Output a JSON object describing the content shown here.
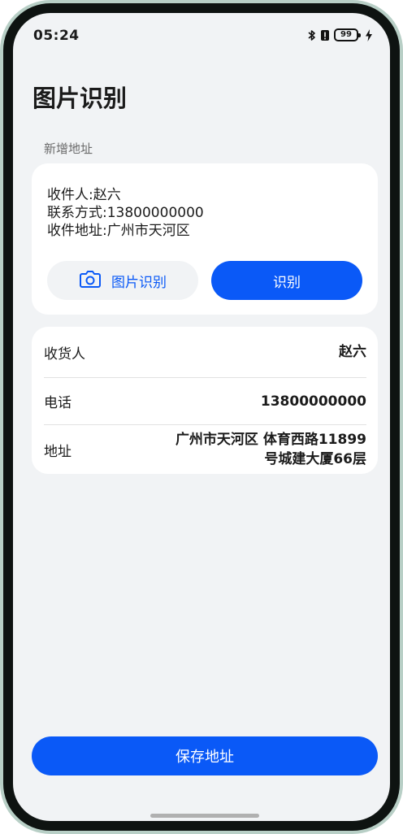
{
  "status_bar": {
    "time": "05:24",
    "battery": "99"
  },
  "page": {
    "title": "图片识别",
    "section_title": "新增地址"
  },
  "recognize_card": {
    "text": "收件人:赵六\n联系方式:13800000000\n收件地址:广州市天河区",
    "image_button_label": "图片识别",
    "recognize_button_label": "识别",
    "image_button_icon": "camera-icon"
  },
  "form": {
    "rows": [
      {
        "label": "收货人",
        "value": "赵六"
      },
      {
        "label": "电话",
        "value": "13800000000"
      },
      {
        "label": "地址",
        "value": "广州市天河区 体育西路11899\n号城建大厦66层"
      }
    ]
  },
  "save_button_label": "保存地址",
  "colors": {
    "accent": "#0a59f7",
    "background": "#f1f3f5",
    "card": "#ffffff"
  }
}
